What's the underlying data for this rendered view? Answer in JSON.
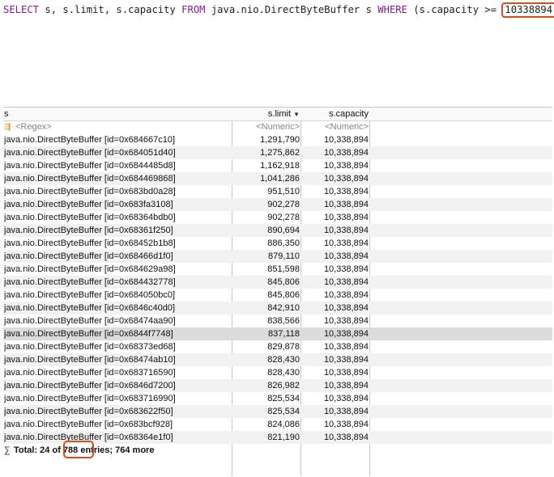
{
  "query": {
    "p1": "SELECT",
    "p2": " s, s.limit, s.capacity ",
    "p3": "FROM",
    "p4": " java.nio.DirectByteBuffer s ",
    "p5": "WHERE",
    "p6": " (s.capacity >= ",
    "value": "10338894",
    "p7": ")"
  },
  "table": {
    "columns": [
      "s",
      "s.limit",
      "s.capacity"
    ],
    "filters": [
      "<Regex>",
      "<Numeric>",
      "<Numeric>"
    ],
    "rows": [
      [
        "java.nio.DirectByteBuffer [id=0x684667c10]",
        "1,291,790",
        "10,338,894"
      ],
      [
        "java.nio.DirectByteBuffer [id=0x684051d40]",
        "1,275,862",
        "10,338,894"
      ],
      [
        "java.nio.DirectByteBuffer [id=0x6844485d8]",
        "1,162,918",
        "10,338,894"
      ],
      [
        "java.nio.DirectByteBuffer [id=0x684469868]",
        "1,041,286",
        "10,338,894"
      ],
      [
        "java.nio.DirectByteBuffer [id=0x683bd0a28]",
        "951,510",
        "10,338,894"
      ],
      [
        "java.nio.DirectByteBuffer [id=0x683fa3108]",
        "902,278",
        "10,338,894"
      ],
      [
        "java.nio.DirectByteBuffer [id=0x68364bdb0]",
        "902,278",
        "10,338,894"
      ],
      [
        "java.nio.DirectByteBuffer [id=0x68361f250]",
        "890,694",
        "10,338,894"
      ],
      [
        "java.nio.DirectByteBuffer [id=0x68452b1b8]",
        "886,350",
        "10,338,894"
      ],
      [
        "java.nio.DirectByteBuffer [id=0x68466d1f0]",
        "879,110",
        "10,338,894"
      ],
      [
        "java.nio.DirectByteBuffer [id=0x684629a98]",
        "851,598",
        "10,338,894"
      ],
      [
        "java.nio.DirectByteBuffer [id=0x684432778]",
        "845,806",
        "10,338,894"
      ],
      [
        "java.nio.DirectByteBuffer [id=0x684050bc0]",
        "845,806",
        "10,338,894"
      ],
      [
        "java.nio.DirectByteBuffer [id=0x6846c40d0]",
        "842,910",
        "10,338,894"
      ],
      [
        "java.nio.DirectByteBuffer [id=0x68474aa90]",
        "838,566",
        "10,338,894"
      ],
      [
        "java.nio.DirectByteBuffer [id=0x6844f7748]",
        "837,118",
        "10,338,894"
      ],
      [
        "java.nio.DirectByteBuffer [id=0x68373ed68]",
        "829,878",
        "10,338,894"
      ],
      [
        "java.nio.DirectByteBuffer [id=0x68474ab10]",
        "828,430",
        "10,338,894"
      ],
      [
        "java.nio.DirectByteBuffer [id=0x683716590]",
        "828,430",
        "10,338,894"
      ],
      [
        "java.nio.DirectByteBuffer [id=0x6846d7200]",
        "826,982",
        "10,338,894"
      ],
      [
        "java.nio.DirectByteBuffer [id=0x683716990]",
        "825,534",
        "10,338,894"
      ],
      [
        "java.nio.DirectByteBuffer [id=0x683622f50]",
        "825,534",
        "10,338,894"
      ],
      [
        "java.nio.DirectByteBuffer [id=0x683bcf928]",
        "824,086",
        "10,338,894"
      ],
      [
        "java.nio.DirectByteBuffer [id=0x68364e1f0]",
        "821,190",
        "10,338,894"
      ]
    ],
    "selected_row": 15,
    "sort_icon": "chevron-down-icon",
    "total": {
      "prefix": "Total: 24 of ",
      "count": "788",
      "suffix": " entries; 764 more"
    }
  },
  "colors": {
    "keyword": "#8b1a8b",
    "highlight_box": "#e04a1c"
  }
}
